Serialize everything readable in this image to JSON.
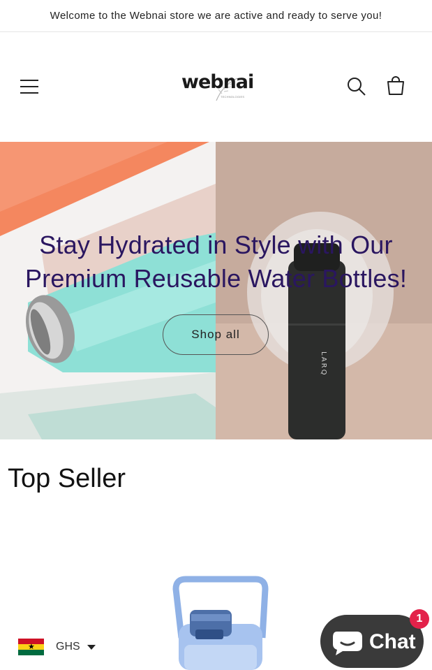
{
  "announcement": {
    "text": "Welcome to the Webnai store we are active and ready to serve you!"
  },
  "header": {
    "logo_text": "webnai",
    "logo_sub": "TECHNOLOGIES",
    "icons": {
      "menu": "hamburger-menu-icon",
      "search": "search-icon",
      "cart": "cart-icon"
    }
  },
  "hero": {
    "title_line1": "Stay Hydrated in Style with Our",
    "title_line2": "Premium Reusable Water Bottles!",
    "button_label": "Shop all",
    "bottle_brand": "LARQ",
    "title_color": "#2a1660"
  },
  "section": {
    "title": "Top Seller"
  },
  "currency": {
    "code": "GHS",
    "flag": "ghana-flag"
  },
  "chat": {
    "label": "Chat",
    "badge_count": "1",
    "bubble_color": "#3a3a3a",
    "badge_color": "#e3224a"
  }
}
